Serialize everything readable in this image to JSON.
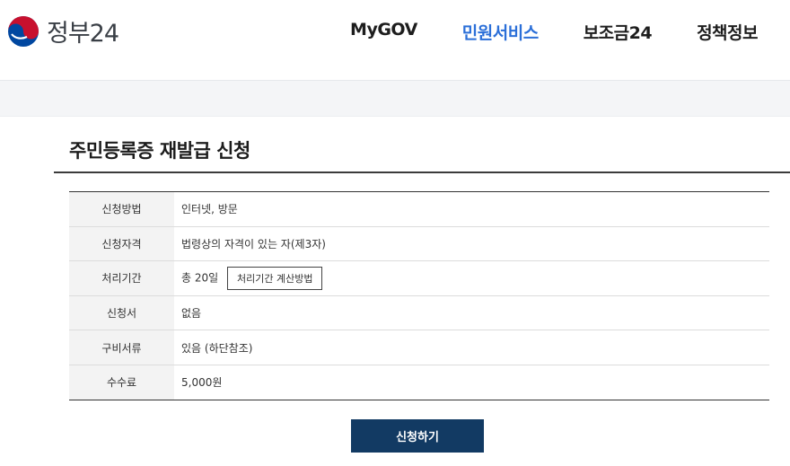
{
  "header": {
    "logo_text": "정부24",
    "nav": [
      {
        "label": "MyGOV",
        "active": false
      },
      {
        "label": "민원서비스",
        "active": true
      },
      {
        "label": "보조금24",
        "active": false
      },
      {
        "label": "정책정보",
        "active": false
      }
    ]
  },
  "colors": {
    "active_nav": "#2b6fd8",
    "apply_button": "#123a63",
    "logo_red": "#c8102e",
    "logo_blue": "#0047a0"
  },
  "page": {
    "title": "주민등록증 재발급 신청"
  },
  "info": {
    "rows": [
      {
        "label": "신청방법",
        "value": "인터넷, 방문"
      },
      {
        "label": "신청자격",
        "value": "법령상의 자격이 있는 자(제3자)"
      },
      {
        "label": "처리기간",
        "value": "총 20일",
        "button": "처리기간 계산방법"
      },
      {
        "label": "신청서",
        "value": "없음"
      },
      {
        "label": "구비서류",
        "value": "있음 (하단참조)"
      },
      {
        "label": "수수료",
        "value": "5,000원"
      }
    ]
  },
  "actions": {
    "apply_label": "신청하기"
  },
  "icons": {
    "logo": "taegeuk-logo-icon"
  }
}
